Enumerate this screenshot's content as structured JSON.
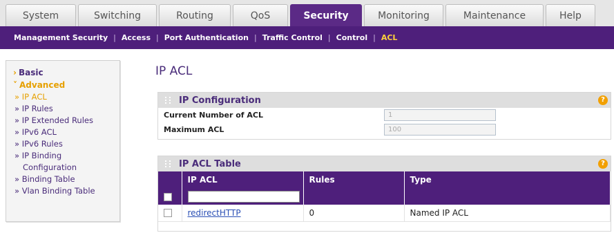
{
  "tabs": [
    {
      "label": "System",
      "active": false
    },
    {
      "label": "Switching",
      "active": false
    },
    {
      "label": "Routing",
      "active": false
    },
    {
      "label": "QoS",
      "active": false
    },
    {
      "label": "Security",
      "active": true
    },
    {
      "label": "Monitoring",
      "active": false
    },
    {
      "label": "Maintenance",
      "active": false
    },
    {
      "label": "Help",
      "active": false
    }
  ],
  "subnav": {
    "items": [
      "Management Security",
      "Access",
      "Port Authentication",
      "Traffic Control",
      "Control",
      "ACL"
    ],
    "separator": "|",
    "active": "ACL"
  },
  "sidebar": {
    "basic": "Basic",
    "advanced": "Advanced",
    "items": [
      "» IP ACL",
      "» IP Rules",
      "» IP Extended Rules",
      "» IPv6 ACL",
      "» IPv6 Rules",
      "» IP Binding",
      "Configuration",
      "» Binding Table",
      "» Vlan Binding Table"
    ]
  },
  "page": {
    "title": "IP ACL"
  },
  "ip_config": {
    "title": "IP Configuration",
    "help": "?",
    "current_label": "Current Number of ACL",
    "current_value": "1",
    "max_label": "Maximum ACL",
    "max_value": "100"
  },
  "acl_table": {
    "title": "IP ACL Table",
    "help": "?",
    "columns": [
      "IP ACL",
      "Rules",
      "Type"
    ],
    "input_value": "",
    "rows": [
      {
        "name": "redirectHTTP",
        "rules": "0",
        "type": "Named IP ACL"
      }
    ]
  },
  "colors": {
    "brand": "#4e1f7b",
    "accent": "#e6a000",
    "link": "#2a4fb5"
  }
}
